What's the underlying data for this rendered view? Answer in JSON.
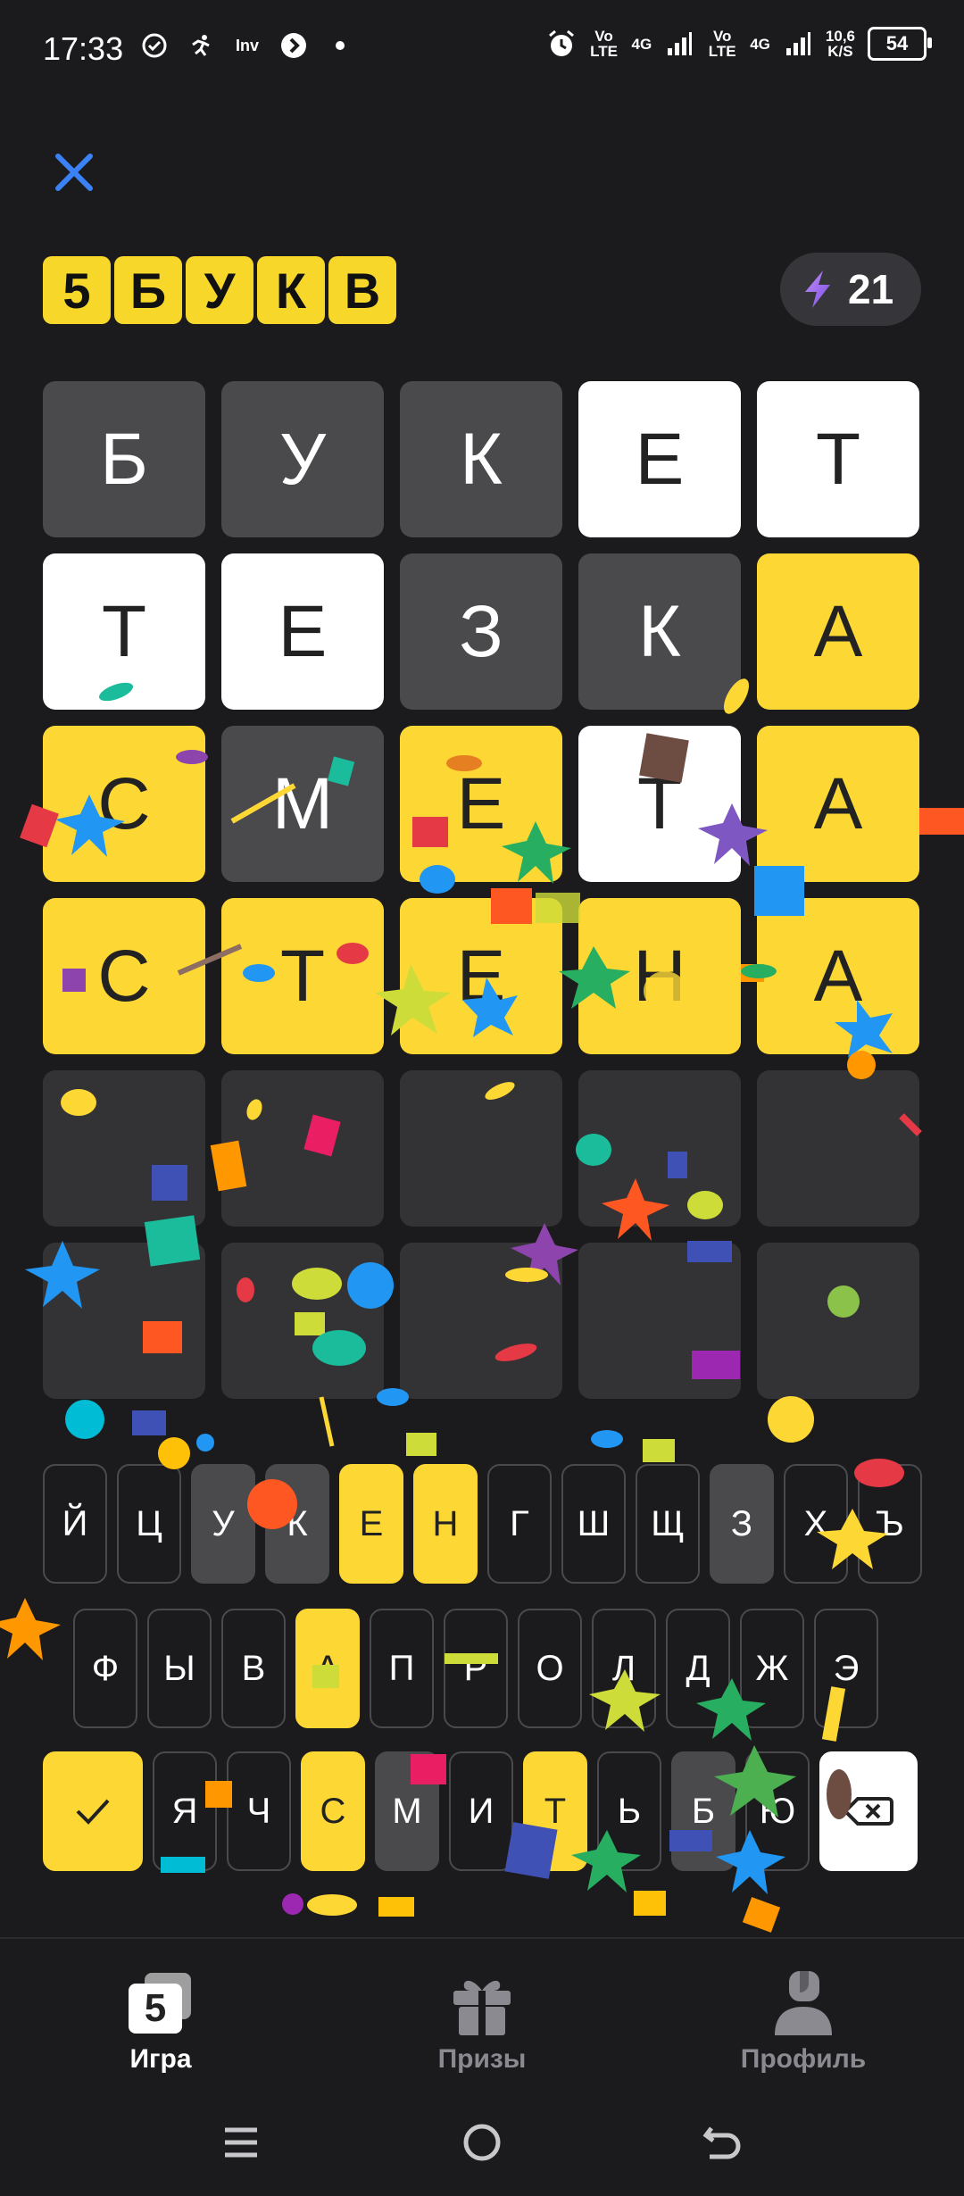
{
  "status_bar": {
    "time": "17:33",
    "network_left": "Vo LTE",
    "network_left2": "4G",
    "network_right": "Vo LTE",
    "network_right2": "4G",
    "speed": "10,6",
    "speed_unit": "K/S",
    "battery": "54"
  },
  "header": {
    "logo_letters": [
      "5",
      "Б",
      "У",
      "К",
      "В"
    ],
    "energy_count": "21"
  },
  "board": {
    "rows": [
      {
        "letters": [
          "Б",
          "У",
          "К",
          "Е",
          "Т"
        ],
        "states": [
          "gray",
          "gray",
          "gray",
          "white",
          "white"
        ]
      },
      {
        "letters": [
          "Т",
          "Е",
          "З",
          "К",
          "А"
        ],
        "states": [
          "white",
          "white",
          "gray",
          "gray",
          "yellow"
        ]
      },
      {
        "letters": [
          "С",
          "М",
          "Е",
          "Т",
          "А"
        ],
        "states": [
          "yellow",
          "gray",
          "yellow",
          "white",
          "yellow"
        ]
      },
      {
        "letters": [
          "С",
          "Т",
          "Е",
          "Н",
          "А"
        ],
        "states": [
          "yellow",
          "yellow",
          "yellow",
          "yellow",
          "yellow"
        ]
      },
      {
        "letters": [
          "",
          "",
          "",
          "",
          ""
        ],
        "states": [
          "empty",
          "empty",
          "empty",
          "empty",
          "empty"
        ]
      },
      {
        "letters": [
          "",
          "",
          "",
          "",
          ""
        ],
        "states": [
          "empty",
          "empty",
          "empty",
          "empty",
          "empty"
        ]
      }
    ]
  },
  "keyboard": {
    "row1": [
      {
        "k": "Й",
        "s": "none"
      },
      {
        "k": "Ц",
        "s": "none"
      },
      {
        "k": "У",
        "s": "gray"
      },
      {
        "k": "К",
        "s": "gray"
      },
      {
        "k": "Е",
        "s": "yellow"
      },
      {
        "k": "Н",
        "s": "yellow"
      },
      {
        "k": "Г",
        "s": "none"
      },
      {
        "k": "Ш",
        "s": "none"
      },
      {
        "k": "Щ",
        "s": "none"
      },
      {
        "k": "З",
        "s": "gray"
      },
      {
        "k": "Х",
        "s": "none"
      },
      {
        "k": "Ъ",
        "s": "none"
      }
    ],
    "row2": [
      {
        "k": "Ф",
        "s": "none"
      },
      {
        "k": "Ы",
        "s": "none"
      },
      {
        "k": "В",
        "s": "none"
      },
      {
        "k": "А",
        "s": "yellow"
      },
      {
        "k": "П",
        "s": "none"
      },
      {
        "k": "Р",
        "s": "none"
      },
      {
        "k": "О",
        "s": "none"
      },
      {
        "k": "Л",
        "s": "none"
      },
      {
        "k": "Д",
        "s": "none"
      },
      {
        "k": "Ж",
        "s": "none"
      },
      {
        "k": "Э",
        "s": "none"
      }
    ],
    "row3": [
      {
        "k": "Я",
        "s": "none"
      },
      {
        "k": "Ч",
        "s": "none"
      },
      {
        "k": "С",
        "s": "yellow"
      },
      {
        "k": "М",
        "s": "gray"
      },
      {
        "k": "И",
        "s": "none"
      },
      {
        "k": "Т",
        "s": "yellow"
      },
      {
        "k": "Ь",
        "s": "none"
      },
      {
        "k": "Б",
        "s": "gray"
      },
      {
        "k": "Ю",
        "s": "none"
      }
    ]
  },
  "tabs": [
    {
      "label": "Игра",
      "icon": "game-5-icon",
      "active": true
    },
    {
      "label": "Призы",
      "icon": "gift-icon",
      "active": false
    },
    {
      "label": "Профиль",
      "icon": "profile-icon",
      "active": false
    }
  ],
  "colors": {
    "yellow": "#fdd835",
    "gray": "#4a4a4d",
    "white": "#ffffff",
    "empty": "#333336",
    "background": "#1b1b1d"
  }
}
